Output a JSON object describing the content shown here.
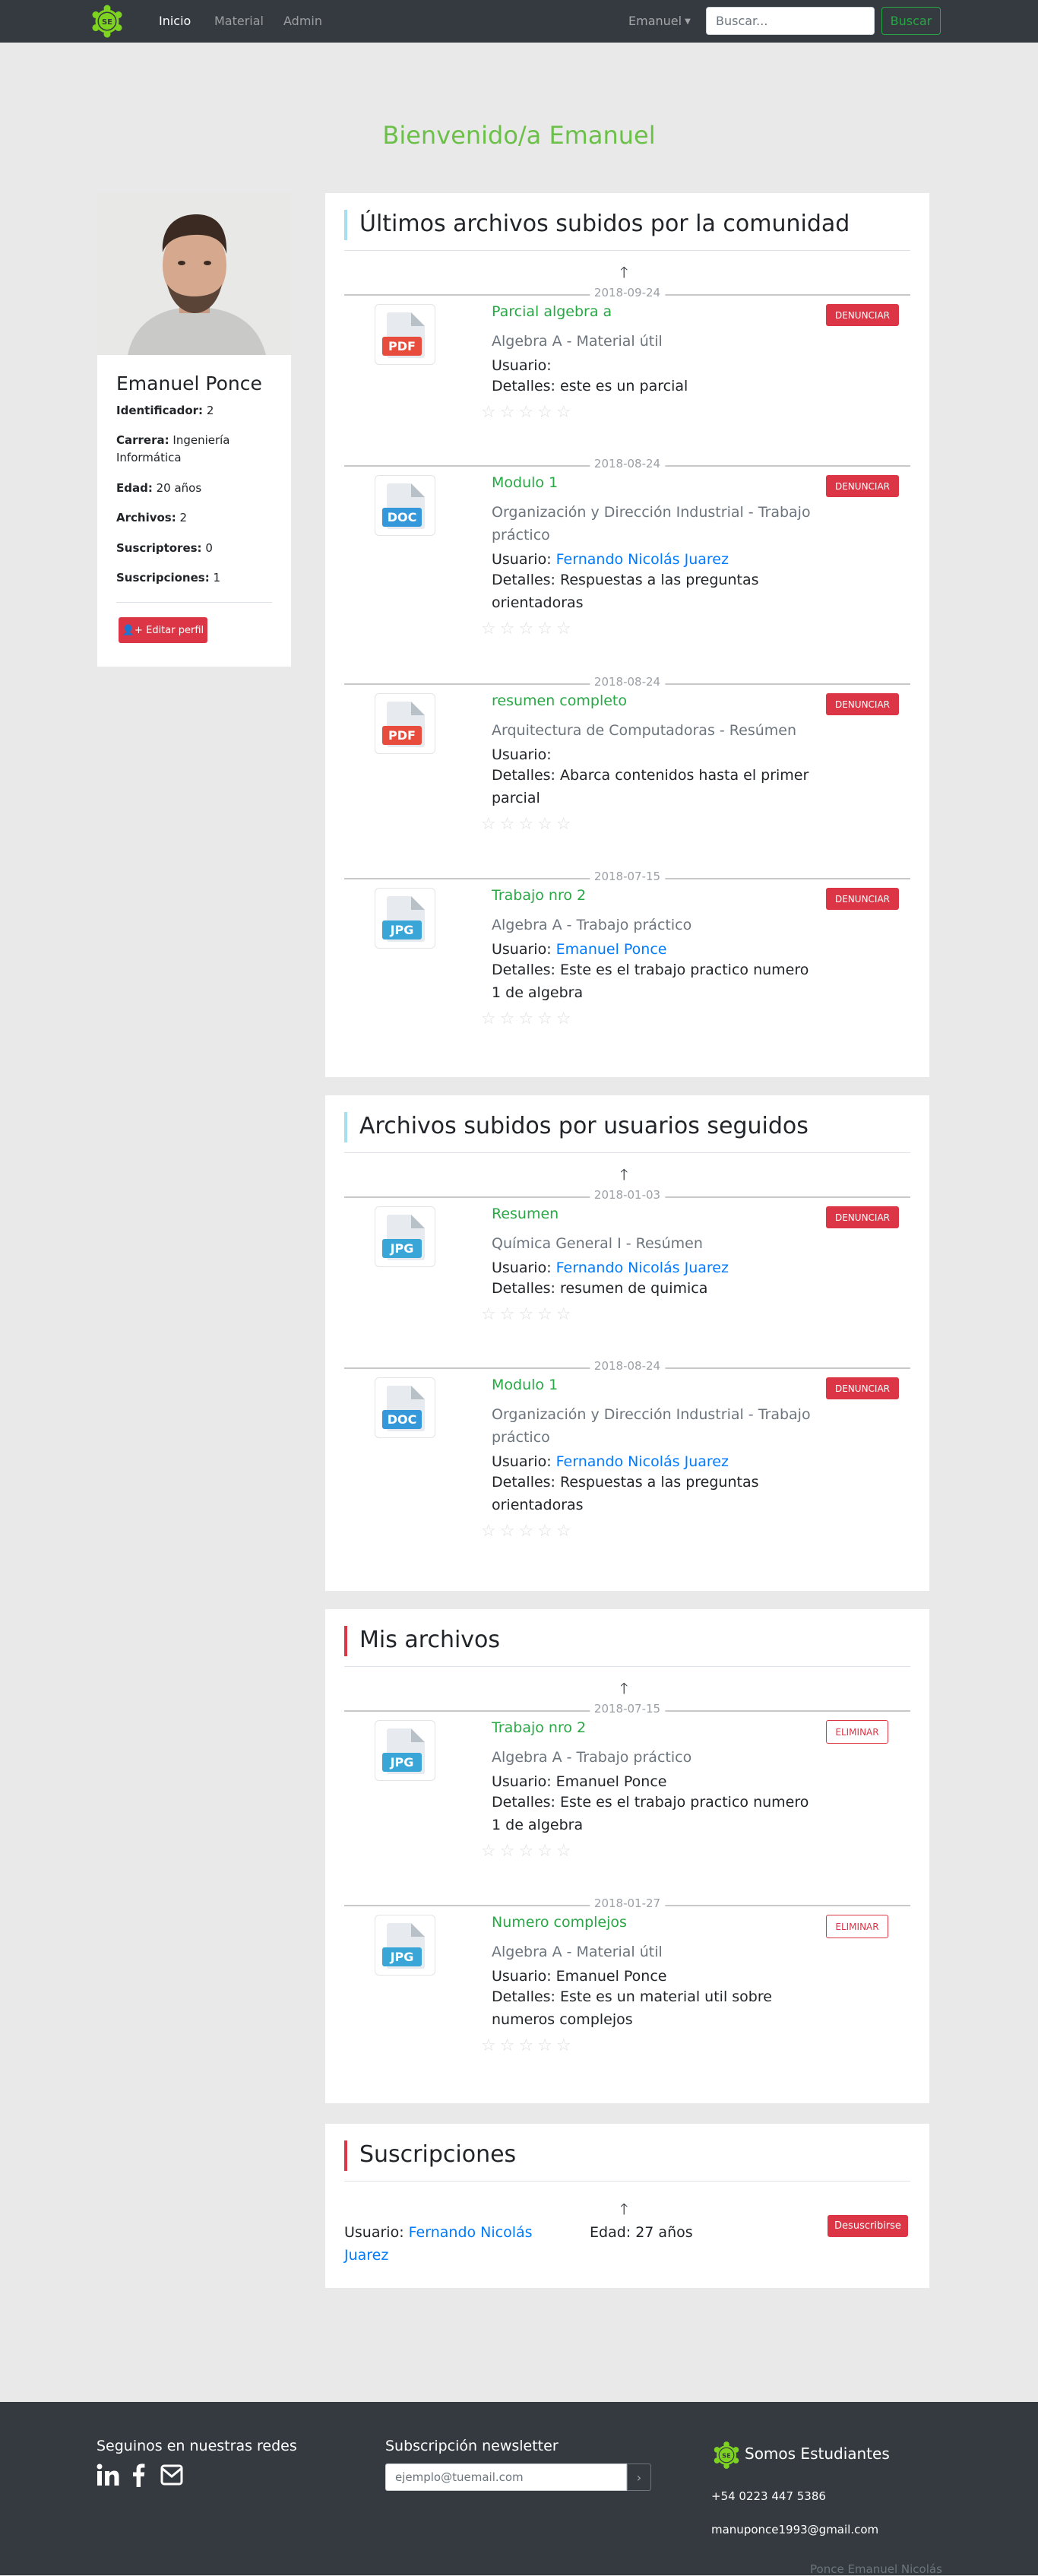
{
  "nav": {
    "logo_text": "SE",
    "links": [
      "Inicio",
      "Material",
      "Admin"
    ],
    "user_label": "Emanuel",
    "search_placeholder": "Buscar...",
    "search_button": "Buscar"
  },
  "welcome": "Bienvenido/a Emanuel",
  "profile": {
    "name": "Emanuel Ponce",
    "fields": [
      {
        "label": "Identificador:",
        "value": " 2"
      },
      {
        "label": "Carrera:",
        "value": " Ingeniería Informática"
      },
      {
        "label": "Edad:",
        "value": " 20 años"
      },
      {
        "label": "Archivos:",
        "value": " 2"
      },
      {
        "label": "Suscriptores:",
        "value": " 0"
      },
      {
        "label": "Suscripciones:",
        "value": " 1"
      }
    ],
    "edit_button": "Editar perfil"
  },
  "user_prefix": "Usuario: ",
  "details_prefix": "Detalles: ",
  "community": {
    "title": "Últimos archivos subidos por la comunidad",
    "items": [
      {
        "date": "2018-09-24",
        "type": "PDF",
        "title": "Parcial algebra a",
        "subtitle": "Algebra A - Material útil",
        "user": "",
        "details": "este es un parcial",
        "action": "DENUNCIAR"
      },
      {
        "date": "2018-08-24",
        "type": "DOC",
        "title": "Modulo 1",
        "subtitle": "Organización y Dirección Industrial - Trabajo práctico",
        "user": "Fernando Nicolás Juarez",
        "details": "Respuestas a las preguntas orientadoras",
        "action": "DENUNCIAR"
      },
      {
        "date": "2018-08-24",
        "type": "PDF",
        "title": "resumen completo",
        "subtitle": "Arquitectura de Computadoras - Resúmen",
        "user": "",
        "details": "Abarca contenidos hasta el primer parcial",
        "action": "DENUNCIAR"
      },
      {
        "date": "2018-07-15",
        "type": "JPG",
        "title": "Trabajo nro 2",
        "subtitle": "Algebra A - Trabajo práctico",
        "user": "Emanuel Ponce",
        "details": "Este es el trabajo practico numero 1 de algebra",
        "action": "DENUNCIAR"
      }
    ]
  },
  "following": {
    "title": "Archivos subidos por usuarios seguidos",
    "items": [
      {
        "date": "2018-01-03",
        "type": "JPG",
        "title": "Resumen",
        "subtitle": "Química General I - Resúmen",
        "user": "Fernando Nicolás Juarez",
        "details": "resumen de quimica",
        "action": "DENUNCIAR"
      },
      {
        "date": "2018-08-24",
        "type": "DOC",
        "title": "Modulo 1",
        "subtitle": "Organización y Dirección Industrial - Trabajo práctico",
        "user": "Fernando Nicolás Juarez",
        "details": "Respuestas a las preguntas orientadoras",
        "action": "DENUNCIAR"
      }
    ]
  },
  "mine": {
    "title": "Mis archivos",
    "items": [
      {
        "date": "2018-07-15",
        "type": "JPG",
        "title": "Trabajo nro 2",
        "subtitle": "Algebra A - Trabajo práctico",
        "user_plain": "Emanuel Ponce",
        "details": "Este es el trabajo practico numero 1 de algebra",
        "action": "ELIMINAR"
      },
      {
        "date": "2018-01-27",
        "type": "JPG",
        "title": "Numero complejos",
        "subtitle": "Algebra A - Material útil",
        "user_plain": "Emanuel Ponce",
        "details": "Este es un material util sobre numeros complejos",
        "action": "ELIMINAR"
      }
    ]
  },
  "subscriptions": {
    "title": "Suscripciones",
    "user": "Fernando Nicolás Juarez",
    "age_label": "Edad: ",
    "age": "27 años",
    "button": "Desuscribirse"
  },
  "footer": {
    "social_title": "Seguinos en nuestras redes",
    "social_icons": [
      "linkedin-icon",
      "facebook-icon",
      "mail-icon"
    ],
    "newsletter_title": "Subscripción newsletter",
    "newsletter_placeholder": "ejemplo@tuemail.com",
    "newsletter_button": "›",
    "brand": "Somos Estudiantes",
    "phone": "+54 0223 447 5386",
    "email": "manuponce1993@gmail.com",
    "credit": "Ponce Emanuel Nicolás"
  },
  "colors": {
    "accent_green": "#28a745",
    "danger": "#dc3545",
    "link": "#007bff",
    "nav_bg": "#343a40"
  },
  "rating": "☆☆☆☆☆"
}
